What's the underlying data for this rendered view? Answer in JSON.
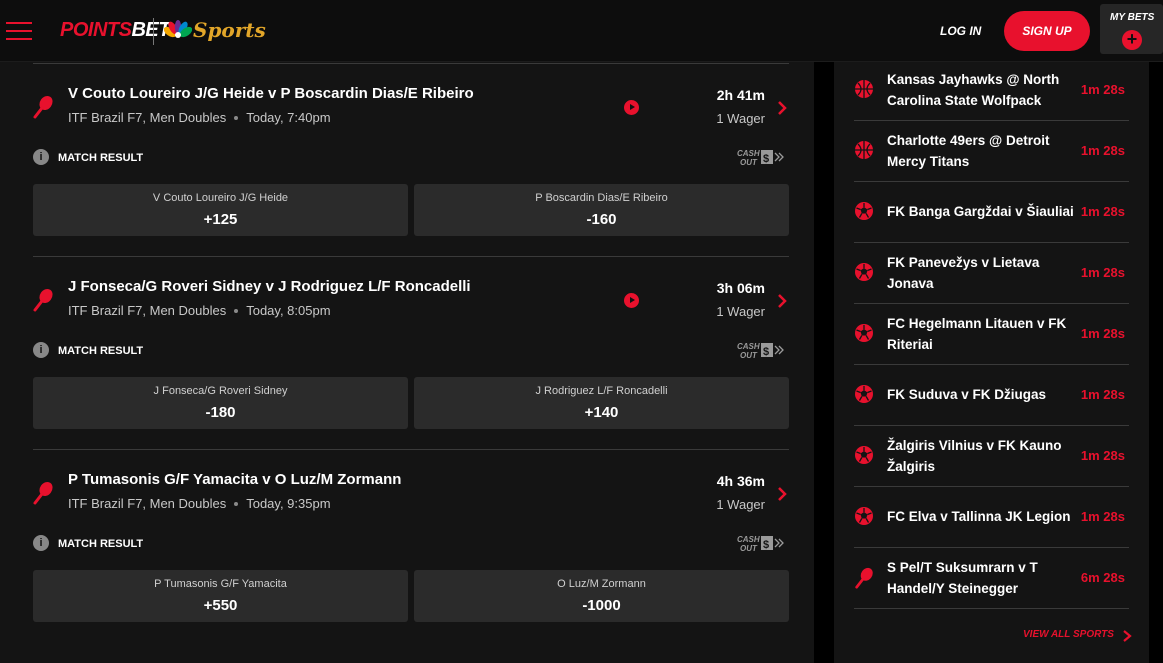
{
  "header": {
    "logo_points": "POINTS",
    "logo_bet": "BET",
    "logo_sports": "Sports",
    "login_label": "LOG IN",
    "signup_label": "SIGN UP",
    "mybets_label": "MY BETS"
  },
  "matches": [
    {
      "title": "V Couto Loureiro J/G Heide v P Boscardin Dias/E Ribeiro",
      "competition": "ITF Brazil F7, Men Doubles",
      "start": "Today, 7:40pm",
      "time_remaining": "2h 41m",
      "wagers": "1 Wager",
      "market_label": "MATCH RESULT",
      "cashout_label": "CASH OUT",
      "outcomes": [
        {
          "name": "V Couto Loureiro J/G Heide",
          "odds": "+125"
        },
        {
          "name": "P Boscardin Dias/E Ribeiro",
          "odds": "-160"
        }
      ]
    },
    {
      "title": "J Fonseca/G Roveri Sidney v J Rodriguez L/F Roncadelli",
      "competition": "ITF Brazil F7, Men Doubles",
      "start": "Today, 8:05pm",
      "time_remaining": "3h 06m",
      "wagers": "1 Wager",
      "market_label": "MATCH RESULT",
      "cashout_label": "CASH OUT",
      "outcomes": [
        {
          "name": "J Fonseca/G Roveri Sidney",
          "odds": "-180"
        },
        {
          "name": "J Rodriguez L/F Roncadelli",
          "odds": "+140"
        }
      ]
    },
    {
      "title": "P Tumasonis G/F Yamacita v O Luz/M Zormann",
      "competition": "ITF Brazil F7, Men Doubles",
      "start": "Today, 9:35pm",
      "time_remaining": "4h 36m",
      "wagers": "1 Wager",
      "market_label": "MATCH RESULT",
      "cashout_label": "CASH OUT",
      "outcomes": [
        {
          "name": "P Tumasonis G/F Yamacita",
          "odds": "+550"
        },
        {
          "name": "O Luz/M Zormann",
          "odds": "-1000"
        }
      ]
    }
  ],
  "upcoming": [
    {
      "name": "Kansas Jayhawks @ North Carolina State Wolfpack",
      "time": "1m 28s",
      "icon": "basketball-icon"
    },
    {
      "name": "Charlotte 49ers @ Detroit Mercy Titans",
      "time": "1m 28s",
      "icon": "basketball-icon"
    },
    {
      "name": "FK Banga Gargždai v Šiauliai",
      "time": "1m 28s",
      "icon": "soccer-ball-icon"
    },
    {
      "name": "FK Panevežys v Lietava Jonava",
      "time": "1m 28s",
      "icon": "soccer-ball-icon"
    },
    {
      "name": "FC Hegelmann Litauen v FK Riteriai",
      "time": "1m 28s",
      "icon": "soccer-ball-icon"
    },
    {
      "name": "FK Suduva v FK Džiugas",
      "time": "1m 28s",
      "icon": "soccer-ball-icon"
    },
    {
      "name": "Žalgiris Vilnius v FK Kauno Žalgiris",
      "time": "1m 28s",
      "icon": "soccer-ball-icon"
    },
    {
      "name": "FC Elva v Tallinna JK Legion",
      "time": "1m 28s",
      "icon": "soccer-ball-icon"
    },
    {
      "name": "S Pel/T Suksumrarn v T Handel/Y Steinegger",
      "time": "6m 28s",
      "icon": "tennis-racket-icon"
    }
  ],
  "view_all_label": "VIEW ALL SPORTS",
  "colors": {
    "accent": "#e8112d",
    "panel": "#141414",
    "button": "#2b2b2b",
    "brand_sports": "#e2a629"
  }
}
